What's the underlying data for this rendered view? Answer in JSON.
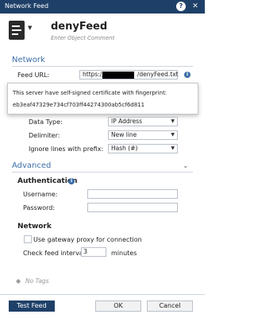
{
  "window": {
    "title": "Network Feed",
    "help": "?",
    "close": "✕"
  },
  "header": {
    "name": "denyFeed",
    "comment_placeholder": "Enter Object Comment"
  },
  "network": {
    "title": "Network",
    "feed_url_label": "Feed URL:",
    "feed_url_prefix": "https://",
    "feed_url_suffix": "/denyFeed.txt",
    "tooltip_line1": "This server have self-signed certificate with fingerprint:",
    "tooltip_line2": "eb3eaf47329e734cf703ff44274300ab5cf6d811",
    "data_type_label": "Data Type:",
    "data_type_value": "IP Address",
    "delimiter_label": "Delimiter:",
    "delimiter_value": "New line",
    "ignore_label": "Ignore lines with prefix:",
    "ignore_value": "Hash (#)"
  },
  "advanced": {
    "title": "Advanced",
    "auth_title": "Authentication",
    "username_label": "Username:",
    "password_label": "Password:",
    "network_title": "Network",
    "proxy_label": "Use gateway proxy for connection",
    "interval_label": "Check feed interval",
    "interval_value": "3",
    "interval_unit": "minutes"
  },
  "tags": {
    "placeholder": "No Tags"
  },
  "footer": {
    "test_label": "Test Feed",
    "ok_label": "OK",
    "cancel_label": "Cancel"
  },
  "colors": {
    "titlebar": "#1e4068",
    "accent": "#3c6ea8"
  }
}
